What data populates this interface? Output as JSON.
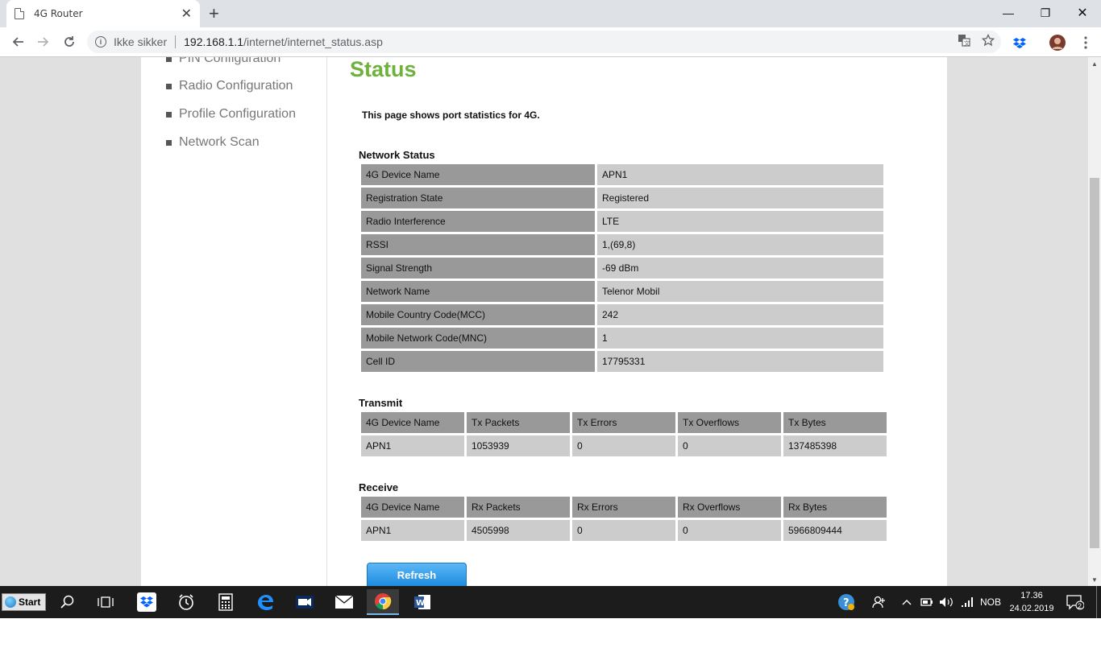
{
  "browser": {
    "tab_title": "4G Router",
    "tab_close": "✕",
    "new_tab": "+",
    "not_secure_label": "Ikke sikker",
    "url_host": "192.168.1.1",
    "url_path": "/internet/internet_status.asp",
    "window_minimize": "—",
    "window_restore": "❐",
    "window_close": "✕"
  },
  "sidebar": {
    "items": [
      {
        "label": "PIN Configuration"
      },
      {
        "label": "Radio Configuration"
      },
      {
        "label": "Profile Configuration"
      },
      {
        "label": "Network Scan"
      }
    ]
  },
  "main": {
    "title": "Status",
    "description": "This page shows port statistics for 4G.",
    "network_status": {
      "title": "Network Status",
      "rows": [
        {
          "key": "4G Device Name",
          "value": "APN1"
        },
        {
          "key": "Registration State",
          "value": "Registered"
        },
        {
          "key": "Radio Interference",
          "value": "LTE"
        },
        {
          "key": "RSSI",
          "value": "1,(69,8)"
        },
        {
          "key": "Signal Strength",
          "value": "-69 dBm"
        },
        {
          "key": "Network Name",
          "value": "Telenor Mobil"
        },
        {
          "key": "Mobile Country Code(MCC)",
          "value": "242"
        },
        {
          "key": "Mobile Network Code(MNC)",
          "value": "1"
        },
        {
          "key": "Cell ID",
          "value": "17795331"
        }
      ]
    },
    "transmit": {
      "title": "Transmit",
      "headers": [
        "4G Device Name",
        "Tx Packets",
        "Tx Errors",
        "Tx Overflows",
        "Tx Bytes"
      ],
      "row": [
        "APN1",
        "1053939",
        "0",
        "0",
        "137485398"
      ]
    },
    "receive": {
      "title": "Receive",
      "headers": [
        "4G Device Name",
        "Rx Packets",
        "Rx Errors",
        "Rx Overflows",
        "Rx Bytes"
      ],
      "row": [
        "APN1",
        "4505998",
        "0",
        "0",
        "5966809444"
      ]
    },
    "refresh_label": "Refresh"
  },
  "taskbar": {
    "start_label": "Start",
    "language": "NOB",
    "time": "17.36",
    "date": "24.02.2019",
    "notification_count": "2"
  },
  "colors": {
    "title_green": "#6fb13a",
    "key_cell": "#999999",
    "value_cell": "#cccccc",
    "refresh_blue": "#1d8ce0"
  }
}
